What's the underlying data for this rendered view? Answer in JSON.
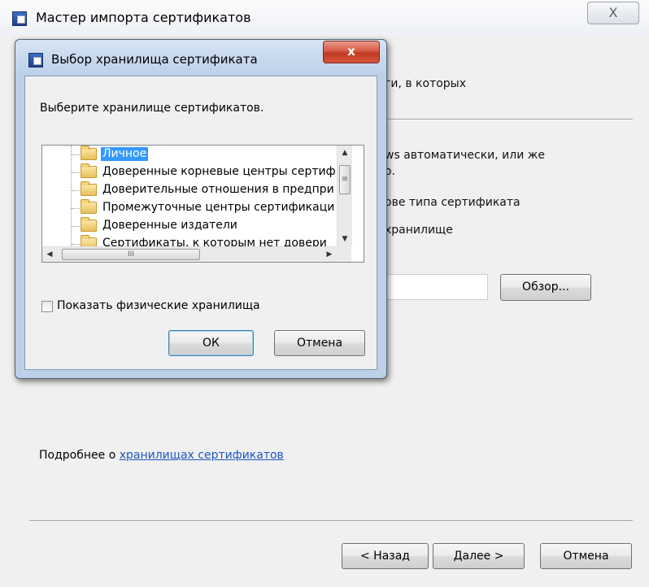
{
  "wizard": {
    "title": "Мастер импорта сертификатов",
    "close_glyph": "X",
    "partial_text_1": "ги, в которых",
    "partial_text_2": "ws автоматически, или же",
    "partial_text_3": "о.",
    "partial_text_4": "ове типа сертификата",
    "partial_text_5": "хранилище",
    "browse_label": "Обзор...",
    "learn_more_prefix": "Подробнее о ",
    "learn_more_link": "хранилищах сертификатов",
    "back_label": "< Назад",
    "next_label": "Далее >",
    "cancel_label": "Отмена"
  },
  "dialog": {
    "title": "Выбор хранилища сертификата",
    "close_glyph": "x",
    "prompt": "Выберите хранилище сертификатов.",
    "stores": [
      {
        "label": "Личное",
        "selected": true
      },
      {
        "label": "Доверенные корневые центры сертиф",
        "selected": false
      },
      {
        "label": "Доверительные отношения в предпри",
        "selected": false
      },
      {
        "label": "Промежуточные центры сертификаци",
        "selected": false
      },
      {
        "label": "Доверенные издатели",
        "selected": false
      },
      {
        "label": "Сертификаты, к которым нет довери",
        "selected": false
      }
    ],
    "show_physical_label": "Показать физические хранилища",
    "show_physical_checked": false,
    "ok_label": "ОК",
    "cancel_label": "Отмена"
  },
  "icons": {
    "wizard_app": "certificate-icon",
    "dialog_app": "certificate-icon",
    "folder": "folder-icon",
    "scroll_up": "▲",
    "scroll_down": "▼",
    "scroll_left": "◀",
    "scroll_right": "▶",
    "grip_v": "≡",
    "grip_h": "III"
  },
  "colors": {
    "selection": "#3399ff",
    "link": "#1a56c4",
    "dialog_close": "#c13a23"
  }
}
